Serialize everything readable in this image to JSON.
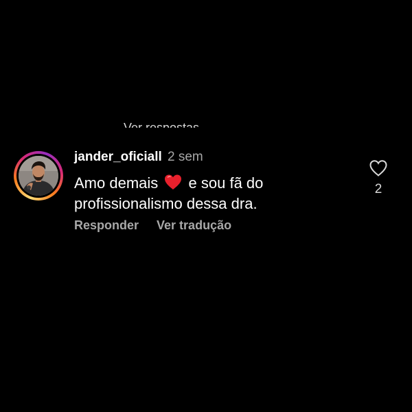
{
  "previous_reply": {
    "truncated_text": "Ver respostas"
  },
  "comment": {
    "username": "jander_oficiall",
    "time_ago": "2 sem",
    "text_part1": "Amo demais",
    "emoji": "red-heart",
    "text_part2": "e sou fã do profissionalismo dessa dra.",
    "reply_label": "Responder",
    "translate_label": "Ver tradução",
    "like_count": "2"
  },
  "icons": {
    "like": "heart-outline-icon",
    "emoji_heart": "red-heart-emoji-icon"
  },
  "colors": {
    "background": "#000000",
    "text_primary": "#ffffff",
    "text_secondary": "#a8a8a8",
    "emoji_heart": "#e8202c"
  }
}
